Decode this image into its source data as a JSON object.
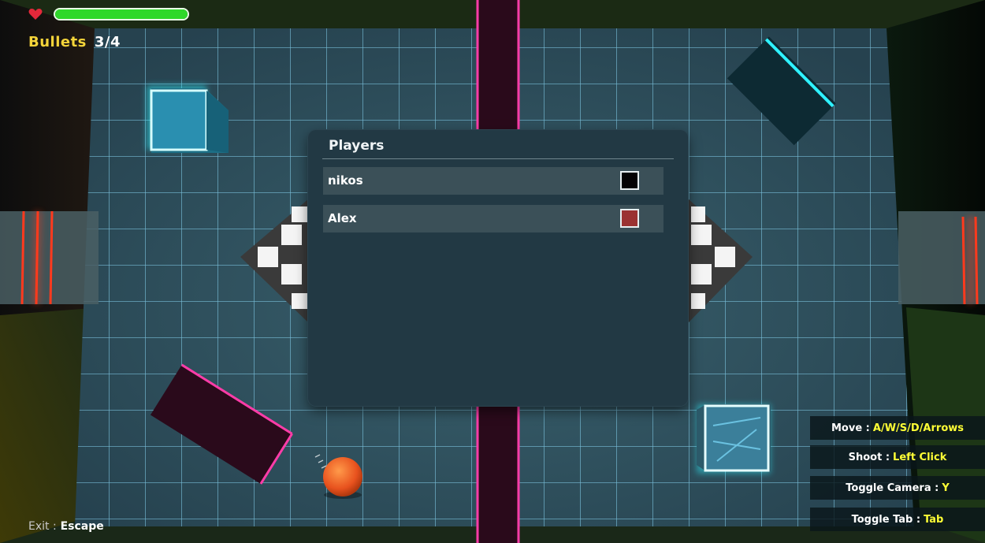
{
  "hud": {
    "health_fraction": 1.0,
    "bullets_label": "Bullets",
    "bullets_value": "3/4"
  },
  "players_panel": {
    "title": "Players",
    "players": [
      {
        "name": "nikos",
        "color": "#050203"
      },
      {
        "name": "Alex",
        "color": "#9b3232"
      }
    ]
  },
  "controls": [
    {
      "label": "Move :",
      "key": "A/W/S/D/Arrows"
    },
    {
      "label": "Shoot :",
      "key": "Left Click"
    },
    {
      "label": "Toggle Camera :",
      "key": "Y"
    },
    {
      "label": "Toggle Tab :",
      "key": "Tab"
    }
  ],
  "exit": {
    "label": "Exit :",
    "key": "Escape"
  },
  "colors": {
    "health": "#2fd82a",
    "bullets_label": "#f4d43a",
    "key_highlight": "#ffff35",
    "panel_bg": "#223944",
    "row_bg": "#3b5058",
    "floor_grid": "#79d6ff",
    "pink_neon": "#ff3ca8",
    "cyan_neon": "#2ff2ff",
    "red_neon": "#ff3a1e"
  },
  "icons": {
    "health": "heart-icon",
    "player": "ball-icon"
  }
}
